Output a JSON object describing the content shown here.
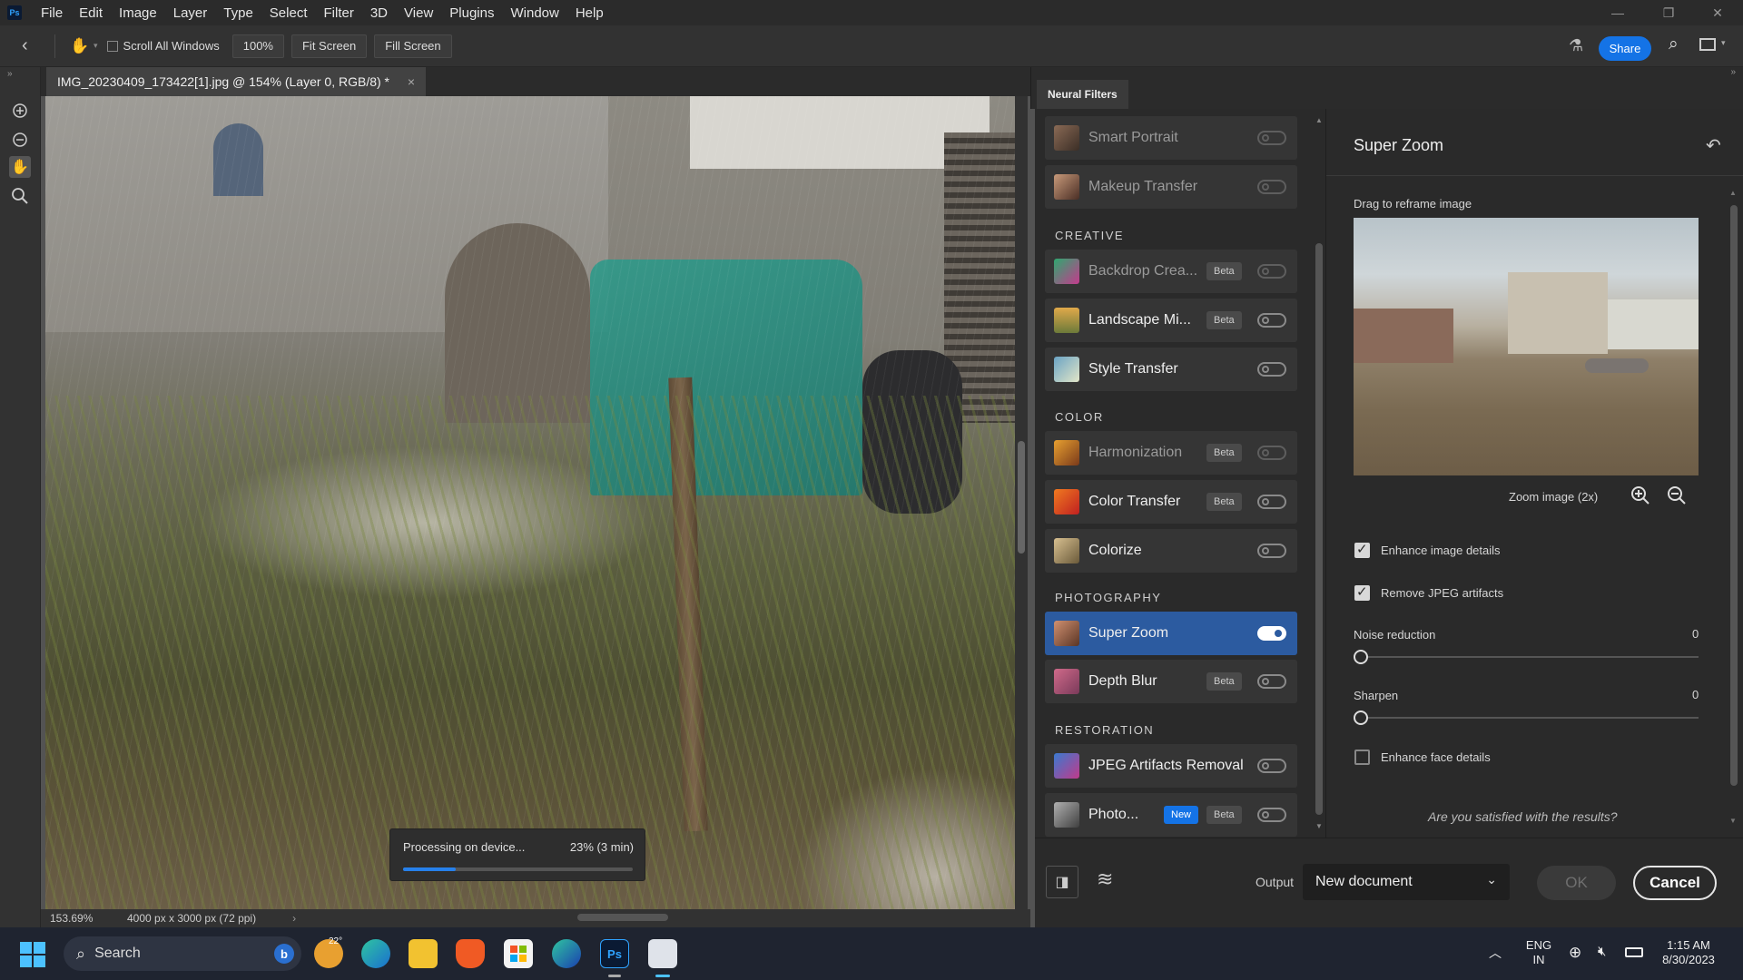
{
  "app": {
    "logo": "Ps",
    "menus": [
      "File",
      "Edit",
      "Image",
      "Layer",
      "Type",
      "Select",
      "Filter",
      "3D",
      "View",
      "Plugins",
      "Window",
      "Help"
    ]
  },
  "options_bar": {
    "scroll_all_windows": "Scroll All Windows",
    "zoom_100": "100%",
    "fit_screen": "Fit Screen",
    "fill_screen": "Fill Screen",
    "share": "Share"
  },
  "document": {
    "tab_title": "IMG_20230409_173422[1].jpg @ 154% (Layer 0, RGB/8) *",
    "zoom": "153.69%",
    "dimensions": "4000 px x 3000 px (72 ppi)"
  },
  "processing": {
    "label": "Processing on device...",
    "status": "23% (3 min)",
    "progress": 0.23
  },
  "neural_filters": {
    "tab": "Neural Filters",
    "featured": [
      {
        "label": "Smart Portrait",
        "enabled": false
      },
      {
        "label": "Makeup Transfer",
        "enabled": false
      }
    ],
    "sections": {
      "creative": "CREATIVE",
      "color": "COLOR",
      "photography": "PHOTOGRAPHY",
      "restoration": "RESTORATION"
    },
    "creative": [
      {
        "label": "Backdrop Crea...",
        "badge": "Beta"
      },
      {
        "label": "Landscape Mi...",
        "badge": "Beta"
      },
      {
        "label": "Style Transfer"
      }
    ],
    "color": [
      {
        "label": "Harmonization",
        "badge": "Beta"
      },
      {
        "label": "Color Transfer",
        "badge": "Beta"
      },
      {
        "label": "Colorize"
      }
    ],
    "photography": [
      {
        "label": "Super Zoom",
        "on": true
      },
      {
        "label": "Depth Blur",
        "badge": "Beta"
      }
    ],
    "restoration": [
      {
        "label": "JPEG Artifacts Removal"
      },
      {
        "label": "Photo...",
        "badge_new": "New",
        "badge": "Beta"
      }
    ]
  },
  "super_zoom": {
    "title": "Super Zoom",
    "drag_hint": "Drag to reframe image",
    "zoom_image": "Zoom image (2x)",
    "enhance_details": "Enhance image details",
    "remove_jpeg": "Remove JPEG artifacts",
    "noise_reduction": "Noise reduction",
    "noise_value": "0",
    "sharpen": "Sharpen",
    "sharpen_value": "0",
    "enhance_face": "Enhance face details",
    "satisfied": "Are you satisfied with the results?"
  },
  "bottom": {
    "output_label": "Output",
    "output_value": "New document",
    "ok": "OK",
    "cancel": "Cancel"
  },
  "taskbar": {
    "search": "Search",
    "weather": "22°",
    "ps_label": "Ps",
    "lang_1": "ENG",
    "lang_2": "IN",
    "time": "1:15 AM",
    "date": "8/30/2023"
  }
}
